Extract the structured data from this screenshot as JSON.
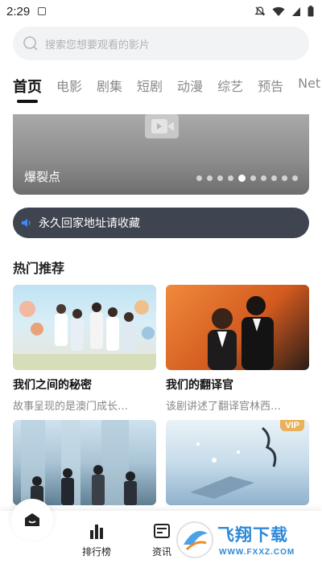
{
  "status_bar": {
    "time": "2:29"
  },
  "search": {
    "placeholder": "搜索您想要观看的影片"
  },
  "tabs": [
    {
      "label": "首页",
      "active": true
    },
    {
      "label": "电影"
    },
    {
      "label": "剧集"
    },
    {
      "label": "短剧"
    },
    {
      "label": "动漫"
    },
    {
      "label": "综艺"
    },
    {
      "label": "预告"
    },
    {
      "label": "Net"
    }
  ],
  "banner": {
    "title": "爆裂点",
    "total_slides": 10,
    "active_slide": 5
  },
  "notice": {
    "text": "永久回家地址请收藏"
  },
  "section": {
    "title": "热门推荐"
  },
  "cards": [
    {
      "name": "我们之间的秘密",
      "desc": "故事呈现的是澳门成长…"
    },
    {
      "name": "我们的翻译官",
      "desc": "该剧讲述了翻译官林西…"
    },
    {
      "name": "",
      "desc": ""
    },
    {
      "name": "",
      "desc": "",
      "badge": "VIP"
    }
  ],
  "bottom_nav": [
    {
      "label": ""
    },
    {
      "label": "排行榜"
    },
    {
      "label": "资讯"
    }
  ],
  "watermark": {
    "brand": "飞翔下载",
    "url": "WWW.FXXZ.COM"
  },
  "colors": {
    "accent_dark": "#3f4451",
    "vip": "#e9b15b",
    "watermark_blue": "#2e89d9"
  }
}
